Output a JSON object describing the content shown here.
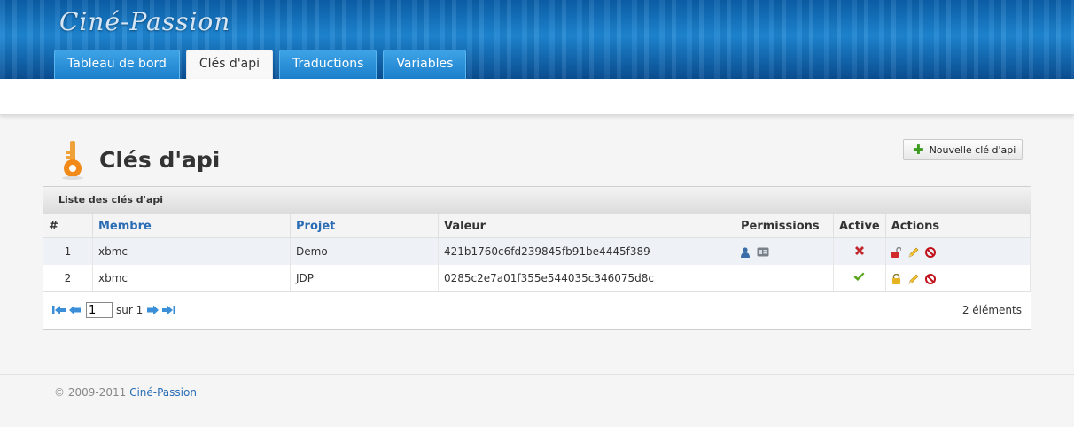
{
  "header": {
    "brand": "Ciné-Passion",
    "tabs": [
      {
        "label": "Tableau de bord",
        "active": false
      },
      {
        "label": "Clés d'api",
        "active": true
      },
      {
        "label": "Traductions",
        "active": false
      },
      {
        "label": "Variables",
        "active": false
      }
    ]
  },
  "page": {
    "title": "Clés d'api",
    "new_button": "Nouvelle clé d'api"
  },
  "grid": {
    "caption": "Liste des clés d'api",
    "columns": [
      "#",
      "Membre",
      "Projet",
      "Valeur",
      "Permissions",
      "Active",
      "Actions"
    ],
    "rows": [
      {
        "num": "1",
        "member": "xbmc",
        "project": "Demo",
        "value": "421b1760c6fd239845fb91be4445f389",
        "permissions": [
          "user-icon",
          "card-icon"
        ],
        "active": false
      },
      {
        "num": "2",
        "member": "xbmc",
        "project": "JDP",
        "value": "0285c2e7a01f355e544035c346075d8c",
        "permissions": [],
        "active": true
      }
    ],
    "pager": {
      "page_value": "1",
      "of_label": "sur 1",
      "count": "2 éléments"
    }
  },
  "footer": {
    "copyright": "© 2009-2011",
    "link": "Ciné-Passion"
  },
  "colors": {
    "header_blue": "#1e86d2",
    "link_blue": "#2a6db5",
    "inactive_red": "#c0282d",
    "active_green": "#5aa51c"
  }
}
